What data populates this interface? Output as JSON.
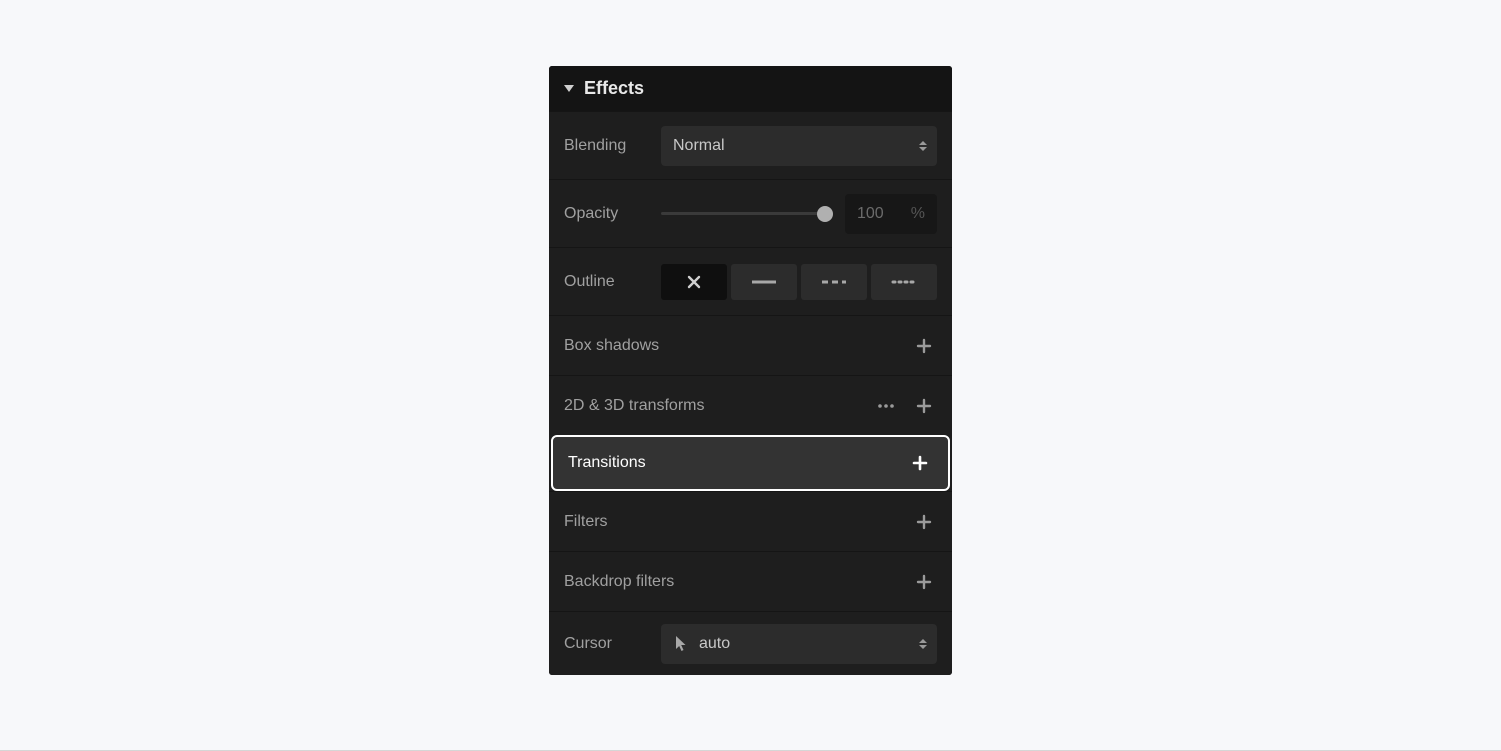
{
  "panel": {
    "title": "Effects",
    "blending": {
      "label": "Blending",
      "value": "Normal"
    },
    "opacity": {
      "label": "Opacity",
      "value": "100",
      "unit": "%"
    },
    "outline": {
      "label": "Outline"
    },
    "rows": {
      "boxShadows": {
        "label": "Box shadows"
      },
      "transforms": {
        "label": "2D & 3D transforms"
      },
      "transitions": {
        "label": "Transitions"
      },
      "filters": {
        "label": "Filters"
      },
      "backdrop": {
        "label": "Backdrop filters"
      }
    },
    "cursor": {
      "label": "Cursor",
      "value": "auto"
    }
  }
}
